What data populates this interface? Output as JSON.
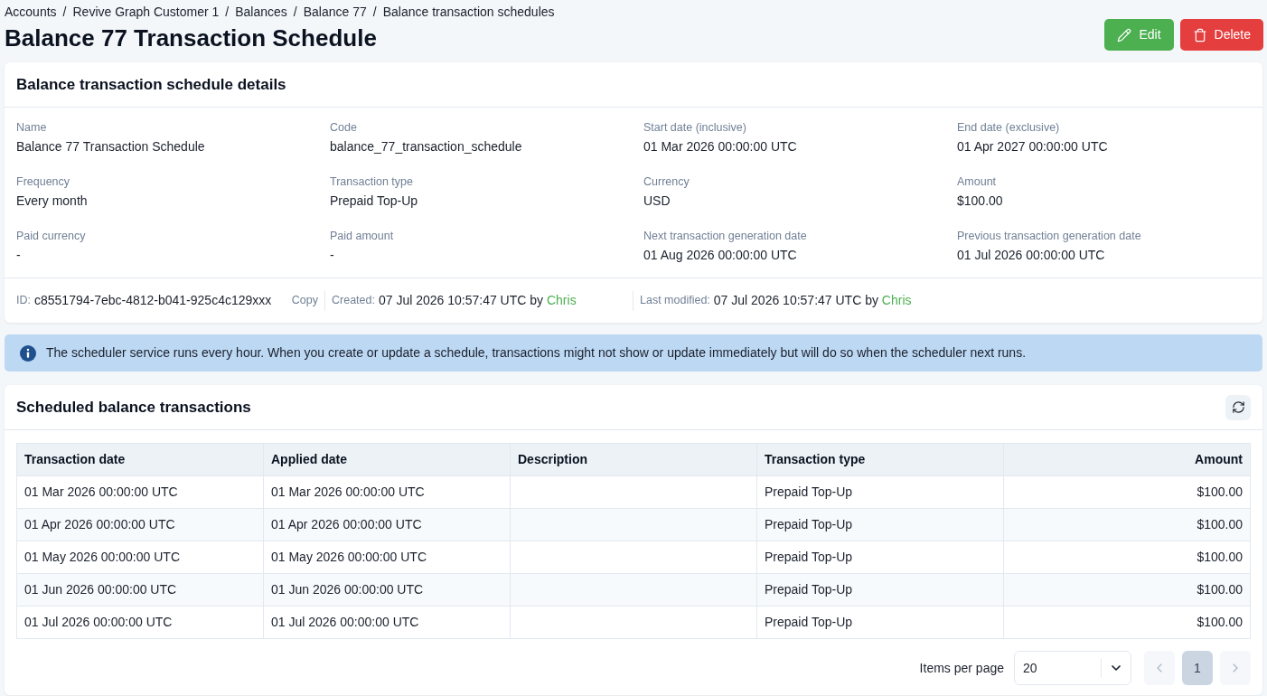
{
  "breadcrumbs": [
    {
      "label": "Accounts",
      "separator": "/"
    },
    {
      "label": "Revive Graph Customer 1",
      "separator": "/"
    },
    {
      "label": "Balances",
      "separator": "/"
    },
    {
      "label": "Balance 77",
      "separator": "/"
    },
    {
      "label": "Balance transaction schedules"
    }
  ],
  "page": {
    "title": "Balance 77 Transaction Schedule",
    "actions": [
      {
        "label": "Edit",
        "kind": "edit"
      },
      {
        "label": "Delete",
        "kind": "delete"
      }
    ]
  },
  "details_card": {
    "title": "Balance transaction schedule details",
    "fields": [
      {
        "label": "Name",
        "value": "Balance 77 Transaction Schedule"
      },
      {
        "label": "Code",
        "value": "balance_77_transaction_schedule"
      },
      {
        "label": "Start date (inclusive)",
        "value": "01 Mar 2026 00:00:00 UTC"
      },
      {
        "label": "End date (exclusive)",
        "value": "01 Apr 2027 00:00:00 UTC"
      },
      {
        "label": "Frequency",
        "value": "Every month"
      },
      {
        "label": "Transaction type",
        "value": "Prepaid Top-Up"
      },
      {
        "label": "Currency",
        "value": "USD"
      },
      {
        "label": "Amount",
        "value": "$100.00"
      },
      {
        "label": "Paid currency",
        "value": "-"
      },
      {
        "label": "Paid amount",
        "value": "-"
      },
      {
        "label": "Next transaction generation date",
        "value": "01 Aug 2026 00:00:00 UTC"
      },
      {
        "label": "Previous transaction generation date",
        "value": "01 Jul 2026 00:00:00 UTC"
      }
    ],
    "meta": {
      "id": {
        "label": "ID:",
        "value": "c8551794-7ebc-4812-b041-925c4c129xxx",
        "copy": "Copy"
      },
      "created": {
        "label": "Created:",
        "text": "07 Jul 2026 10:57:47 UTC by",
        "user": "Chris"
      },
      "modified": {
        "label": "Last modified:",
        "text": "07 Jul 2026 10:57:47 UTC by",
        "user": "Chris"
      }
    }
  },
  "alert": {
    "text": "The scheduler service runs every hour. When you create or update a schedule, transactions might not show or update immediately but will do so when the scheduler next runs."
  },
  "transactions_card": {
    "title": "Scheduled balance transactions",
    "table": {
      "columns": [
        {
          "label": "Transaction date"
        },
        {
          "label": "Applied date"
        },
        {
          "label": "Description"
        },
        {
          "label": "Transaction type"
        },
        {
          "label": "Amount"
        }
      ],
      "rows": [
        {
          "transaction_date": "01 Mar 2026 00:00:00 UTC",
          "applied_date": "01 Mar 2026 00:00:00 UTC",
          "transaction_type": "Prepaid Top-Up",
          "amount": "$100.00"
        },
        {
          "transaction_date": "01 Apr 2026 00:00:00 UTC",
          "applied_date": "01 Apr 2026 00:00:00 UTC",
          "transaction_type": "Prepaid Top-Up",
          "amount": "$100.00"
        },
        {
          "transaction_date": "01 May 2026 00:00:00 UTC",
          "applied_date": "01 May 2026 00:00:00 UTC",
          "transaction_type": "Prepaid Top-Up",
          "amount": "$100.00"
        },
        {
          "transaction_date": "01 Jun 2026 00:00:00 UTC",
          "applied_date": "01 Jun 2026 00:00:00 UTC",
          "transaction_type": "Prepaid Top-Up",
          "amount": "$100.00"
        },
        {
          "transaction_date": "01 Jul 2026 00:00:00 UTC",
          "applied_date": "01 Jul 2026 00:00:00 UTC",
          "transaction_type": "Prepaid Top-Up",
          "amount": "$100.00"
        }
      ]
    },
    "pagination": {
      "items_per_page_label": "Items per page",
      "page_size": "20",
      "prev": {
        "disabled": true
      },
      "pages": [
        {
          "label": "1",
          "selected": true
        }
      ],
      "next": {
        "disabled": true
      }
    }
  }
}
